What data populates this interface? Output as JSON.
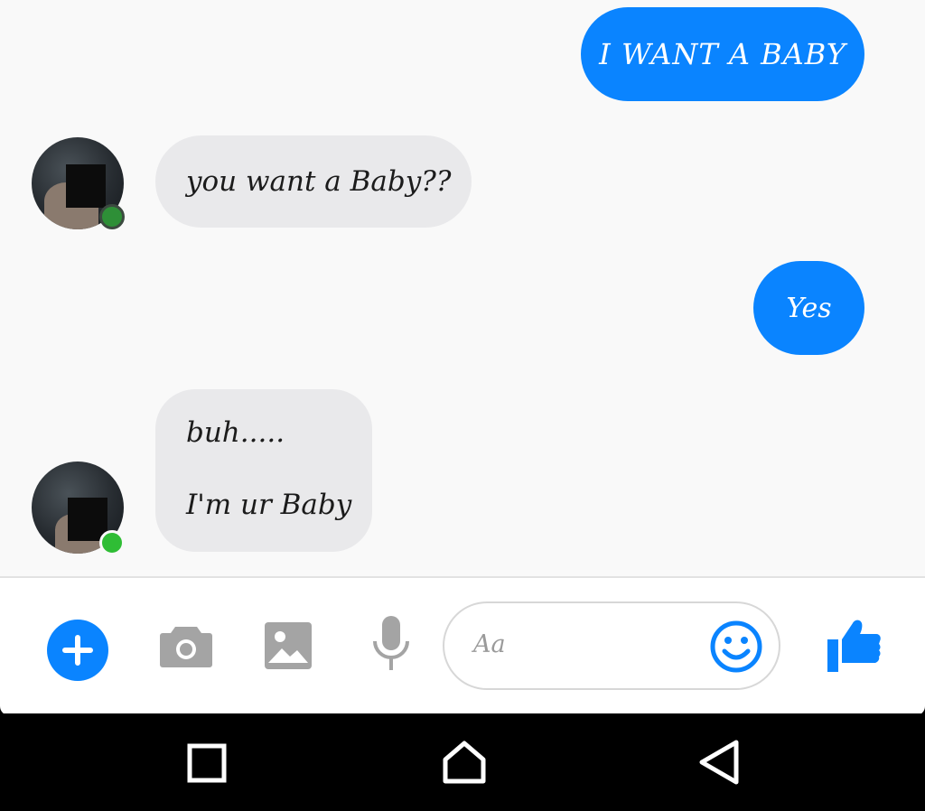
{
  "messages": [
    {
      "direction": "outgoing",
      "text": "I WANT A BABY"
    },
    {
      "direction": "incoming",
      "text": "you want a Baby??"
    },
    {
      "direction": "outgoing",
      "text": "Yes"
    },
    {
      "direction": "incoming",
      "lines": [
        "buh.....",
        "I'm ur Baby"
      ]
    }
  ],
  "composer": {
    "placeholder": "Aa",
    "icons": [
      "plus-icon",
      "camera-icon",
      "image-icon",
      "microphone-icon",
      "smiley-icon",
      "thumbs-up-icon"
    ]
  },
  "navbar": {
    "icons": [
      "recent-apps-icon",
      "home-icon",
      "back-icon"
    ]
  },
  "colors": {
    "accent": "#0a84ff",
    "incoming_bubble": "#e9e9eb",
    "presence": "#2fbd35"
  }
}
